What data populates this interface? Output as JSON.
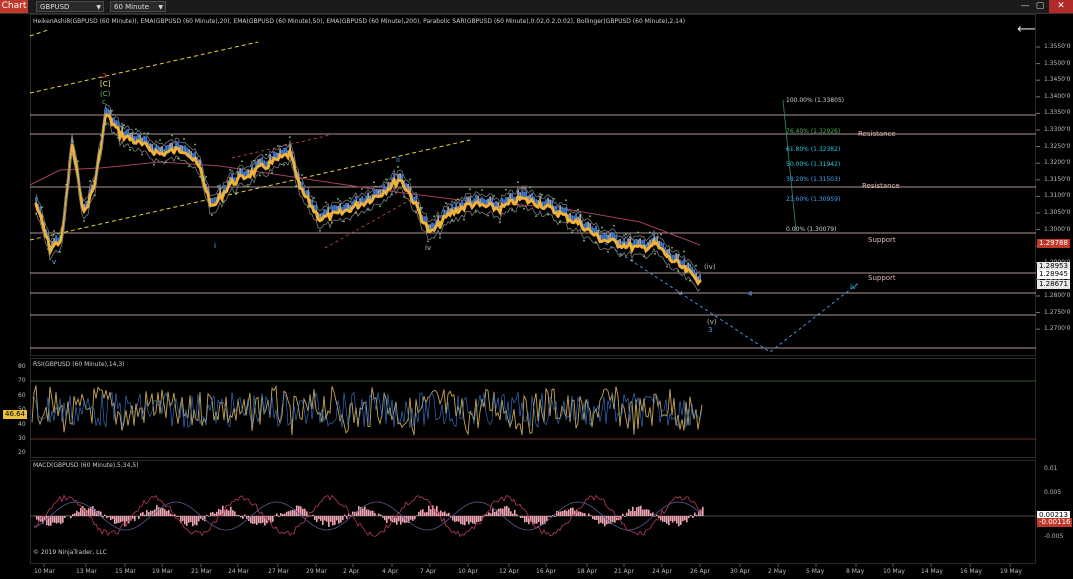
{
  "app": {
    "tab_label": "Chart",
    "instrument": "GBPUSD",
    "interval": "60 Minute",
    "back_glyph": "⟵",
    "win_min": "—",
    "win_max": "▢",
    "win_close": "✕"
  },
  "price_panel": {
    "legend": "HeikenAshi8(GBPUSD (60 Minute)), EMA(GBPUSD (60 Minute),20), EMA(GBPUSD (60 Minute),50), EMA(GBPUSD (60 Minute),200), Parabolic SAR(GBPUSD (60 Minute),0.02,0.2,0.02), Bollinger(GBPUSD (60 Minute),2,14)",
    "y_ticks": [
      "1.3550'0",
      "1.3500'0",
      "1.3450'0",
      "1.3400'0",
      "1.3350'0",
      "1.3300'0",
      "1.3250'0",
      "1.3200'0",
      "1.3150'0",
      "1.3100'0",
      "1.3050'0",
      "1.3000'0",
      "1.2950'0",
      "1.2900'0",
      "1.2850'0",
      "1.2800'0",
      "1.2750'0",
      "1.2700'0"
    ],
    "price_tags": [
      {
        "text": "1.29788",
        "bg": "#c0392b",
        "fg": "#fff"
      },
      {
        "text": "1.28953",
        "bg": "#e8e8e8",
        "fg": "#000"
      },
      {
        "text": "1.28945",
        "bg": "#ffffff",
        "fg": "#000"
      },
      {
        "text": "1.28671",
        "bg": "#e8e8e8",
        "fg": "#000"
      }
    ],
    "sr_labels": [
      "Resistance",
      "Resistance",
      "Support",
      "Support"
    ],
    "fib_levels": [
      {
        "text": "100.00% (1.33805)",
        "color": "#cfcfcf"
      },
      {
        "text": "76.40% (1.32926)",
        "color": "#4caf50"
      },
      {
        "text": "61.80% (1.32382)",
        "color": "#26c6da"
      },
      {
        "text": "50.00% (1.31942)",
        "color": "#26c6da"
      },
      {
        "text": "38.20% (1.31503)",
        "color": "#42a5f5"
      },
      {
        "text": "23.60% (1.30959)",
        "color": "#42a5f5"
      },
      {
        "text": "0.00% (1.30079)",
        "color": "#cfcfcf"
      }
    ],
    "wave_labels": [
      "2",
      "[C]",
      "(C)",
      "c",
      "v",
      "i",
      "ii",
      "iii",
      "iv",
      "(iv)",
      "(v)",
      "3",
      "4",
      "iv",
      "v"
    ]
  },
  "rsi_panel": {
    "legend": "RSI(GBPUSD (60 Minute),14,3)",
    "y_ticks": [
      "80",
      "70",
      "60",
      "50",
      "40",
      "30",
      "20"
    ],
    "current_tag": "46.64"
  },
  "macd_panel": {
    "legend": "MACD(GBPUSD (60 Minute),5,34,5)",
    "y_ticks": [
      "0.01",
      "0.005",
      "0",
      "-0.005"
    ],
    "tags": [
      {
        "text": "0.00213",
        "bg": "#ffffff",
        "fg": "#000"
      },
      {
        "text": "-0.00116",
        "bg": "#c0392b",
        "fg": "#fff"
      }
    ],
    "copyright": "© 2019 NinjaTrader, LLC"
  },
  "x_axis": {
    "labels": [
      "10 Mar",
      "13 Mar",
      "15 Mar",
      "19 Mar",
      "21 Mar",
      "24 Mar",
      "27 Mar",
      "29 Mar",
      "2 Apr",
      "4 Apr",
      "7 Apr",
      "10 Apr",
      "12 Apr",
      "16 Apr",
      "18 Apr",
      "21 Apr",
      "24 Apr",
      "26 Apr",
      "30 Apr",
      "2 May",
      "5 May",
      "8 May",
      "10 May",
      "14 May",
      "16 May",
      "19 May"
    ]
  }
}
